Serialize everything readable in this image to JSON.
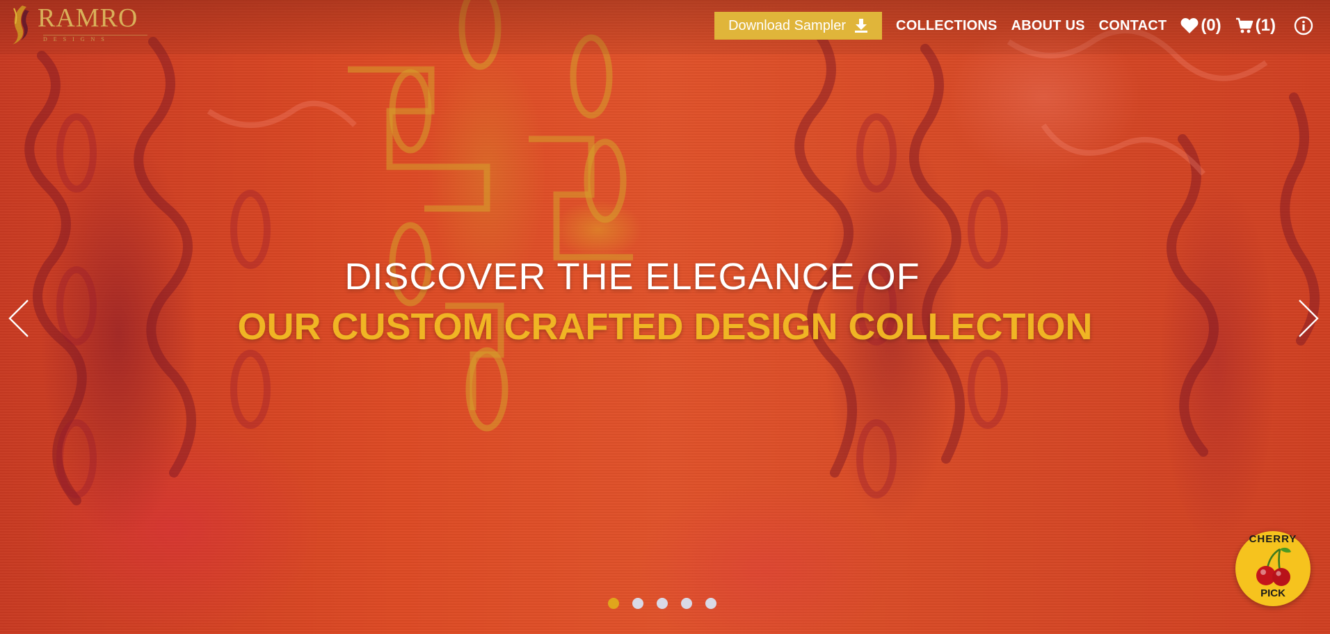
{
  "brand": {
    "name": "RAMRO",
    "tagline": "DESIGNS"
  },
  "header": {
    "sampler_button": "Download Sampler",
    "sampler_icon": "download-icon",
    "nav": [
      {
        "label": "COLLECTIONS"
      },
      {
        "label": "ABOUT US"
      },
      {
        "label": "CONTACT"
      }
    ],
    "wishlist": {
      "icon": "heart-icon",
      "count": "(0)"
    },
    "cart": {
      "icon": "cart-icon",
      "count": "(1)"
    },
    "info_icon": "info-icon"
  },
  "hero": {
    "line1": "DISCOVER THE ELEGANCE OF",
    "line2": "OUR CUSTOM CRAFTED DESIGN COLLECTION",
    "prev_icon": "chevron-left-icon",
    "next_icon": "chevron-right-icon",
    "slides_total": 5,
    "active_slide": 1
  },
  "badge": {
    "top": "CHERRY",
    "bottom": "PICK",
    "icon": "cherry-icon"
  },
  "colors": {
    "accent_gold": "#e0b53a",
    "headline_gold": "#f0b524",
    "background_red": "#d8421f",
    "badge_yellow": "#f6c31e"
  }
}
